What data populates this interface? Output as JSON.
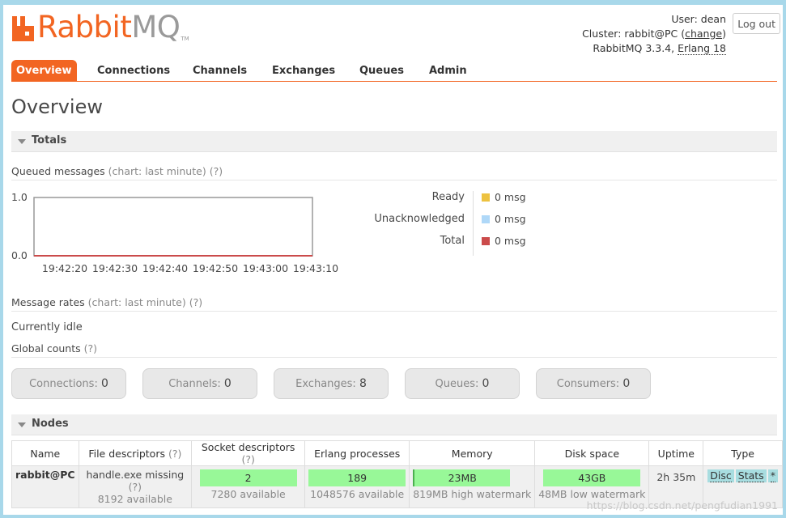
{
  "logo": {
    "rabbit": "Rabbit",
    "mq": "MQ",
    "tm": "TM"
  },
  "user": {
    "user_prefix": "User: ",
    "user_name": "dean",
    "cluster_prefix": "Cluster: ",
    "cluster_name": "rabbit@PC",
    "change_label": "change",
    "version": "RabbitMQ 3.3.4, ",
    "erlang": "Erlang 18",
    "logout_label": "Log out"
  },
  "tabs": [
    "Overview",
    "Connections",
    "Channels",
    "Exchanges",
    "Queues",
    "Admin"
  ],
  "page_title": "Overview",
  "totals": {
    "section_label": "Totals",
    "queued_label": "Queued messages",
    "queued_hint": "(chart: last minute)",
    "help": "(?)",
    "legend": [
      {
        "label": "Ready",
        "value": "0 msg",
        "color": "#edc240"
      },
      {
        "label": "Unacknowledged",
        "value": "0 msg",
        "color": "#afd8f8"
      },
      {
        "label": "Total",
        "value": "0 msg",
        "color": "#cb4b4b"
      }
    ],
    "rates_label": "Message rates",
    "rates_hint": "(chart: last minute)",
    "idle_text": "Currently idle",
    "global_label": "Global counts"
  },
  "chart_data": {
    "type": "line",
    "x": [
      "19:42:20",
      "19:42:30",
      "19:42:40",
      "19:42:50",
      "19:43:00",
      "19:43:10"
    ],
    "series": [
      {
        "name": "Ready",
        "values": [
          0,
          0,
          0,
          0,
          0,
          0
        ],
        "color": "#edc240"
      },
      {
        "name": "Unacknowledged",
        "values": [
          0,
          0,
          0,
          0,
          0,
          0
        ],
        "color": "#afd8f8"
      },
      {
        "name": "Total",
        "values": [
          0,
          0,
          0,
          0,
          0,
          0
        ],
        "color": "#cb4b4b"
      }
    ],
    "yticks": [
      "0.0",
      "1.0"
    ],
    "ylim": [
      0,
      1
    ],
    "title": "",
    "xlabel": "",
    "ylabel": ""
  },
  "counts": [
    {
      "label": "Connections: ",
      "value": "0"
    },
    {
      "label": "Channels: ",
      "value": "0"
    },
    {
      "label": "Exchanges: ",
      "value": "8"
    },
    {
      "label": "Queues: ",
      "value": "0"
    },
    {
      "label": "Consumers: ",
      "value": "0"
    }
  ],
  "nodes": {
    "section_label": "Nodes",
    "headers": {
      "name": "Name",
      "fd": "File descriptors",
      "sd": "Socket descriptors",
      "ep": "Erlang processes",
      "mem": "Memory",
      "disk": "Disk space",
      "uptime": "Uptime",
      "type": "Type"
    },
    "row": {
      "name": "rabbit@PC",
      "fd_main": "handle.exe missing",
      "fd_sub": "8192 available",
      "sd_value": "2",
      "sd_sub": "7280 available",
      "ep_value": "189",
      "ep_sub": "1048576 available",
      "mem_value": "23MB",
      "mem_sub": "819MB high watermark",
      "disk_value": "43GB",
      "disk_sub": "48MB low watermark",
      "uptime": "2h 35m",
      "types": [
        "Disc",
        "Stats",
        "*"
      ]
    }
  },
  "watermark": "https://blog.csdn.net/pengfudian1991"
}
